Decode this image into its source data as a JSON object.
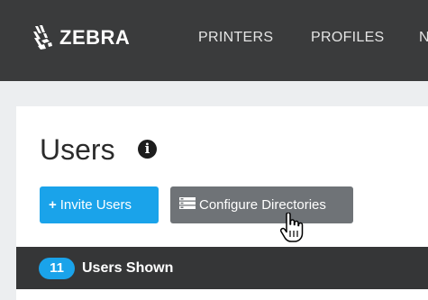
{
  "brand": {
    "name": "ZEBRA",
    "logo_icon": "zebra-head-icon"
  },
  "nav": {
    "items": [
      {
        "label": "PRINTERS"
      },
      {
        "label": "PROFILES"
      },
      {
        "label": "N"
      }
    ]
  },
  "page": {
    "title": "Users",
    "info_icon": "info-icon",
    "info_glyph": "i"
  },
  "actions": {
    "invite": {
      "label": "Invite Users",
      "icon": "plus-icon",
      "glyph": "+"
    },
    "configure": {
      "label": "Configure Directories",
      "icon": "server-icon"
    }
  },
  "list": {
    "count": "11",
    "shown_label": "Users Shown"
  },
  "colors": {
    "topbar": "#3a3b3c",
    "accent": "#1aa3ea",
    "secondary_button": "#6f7377",
    "list_header": "#353637"
  }
}
